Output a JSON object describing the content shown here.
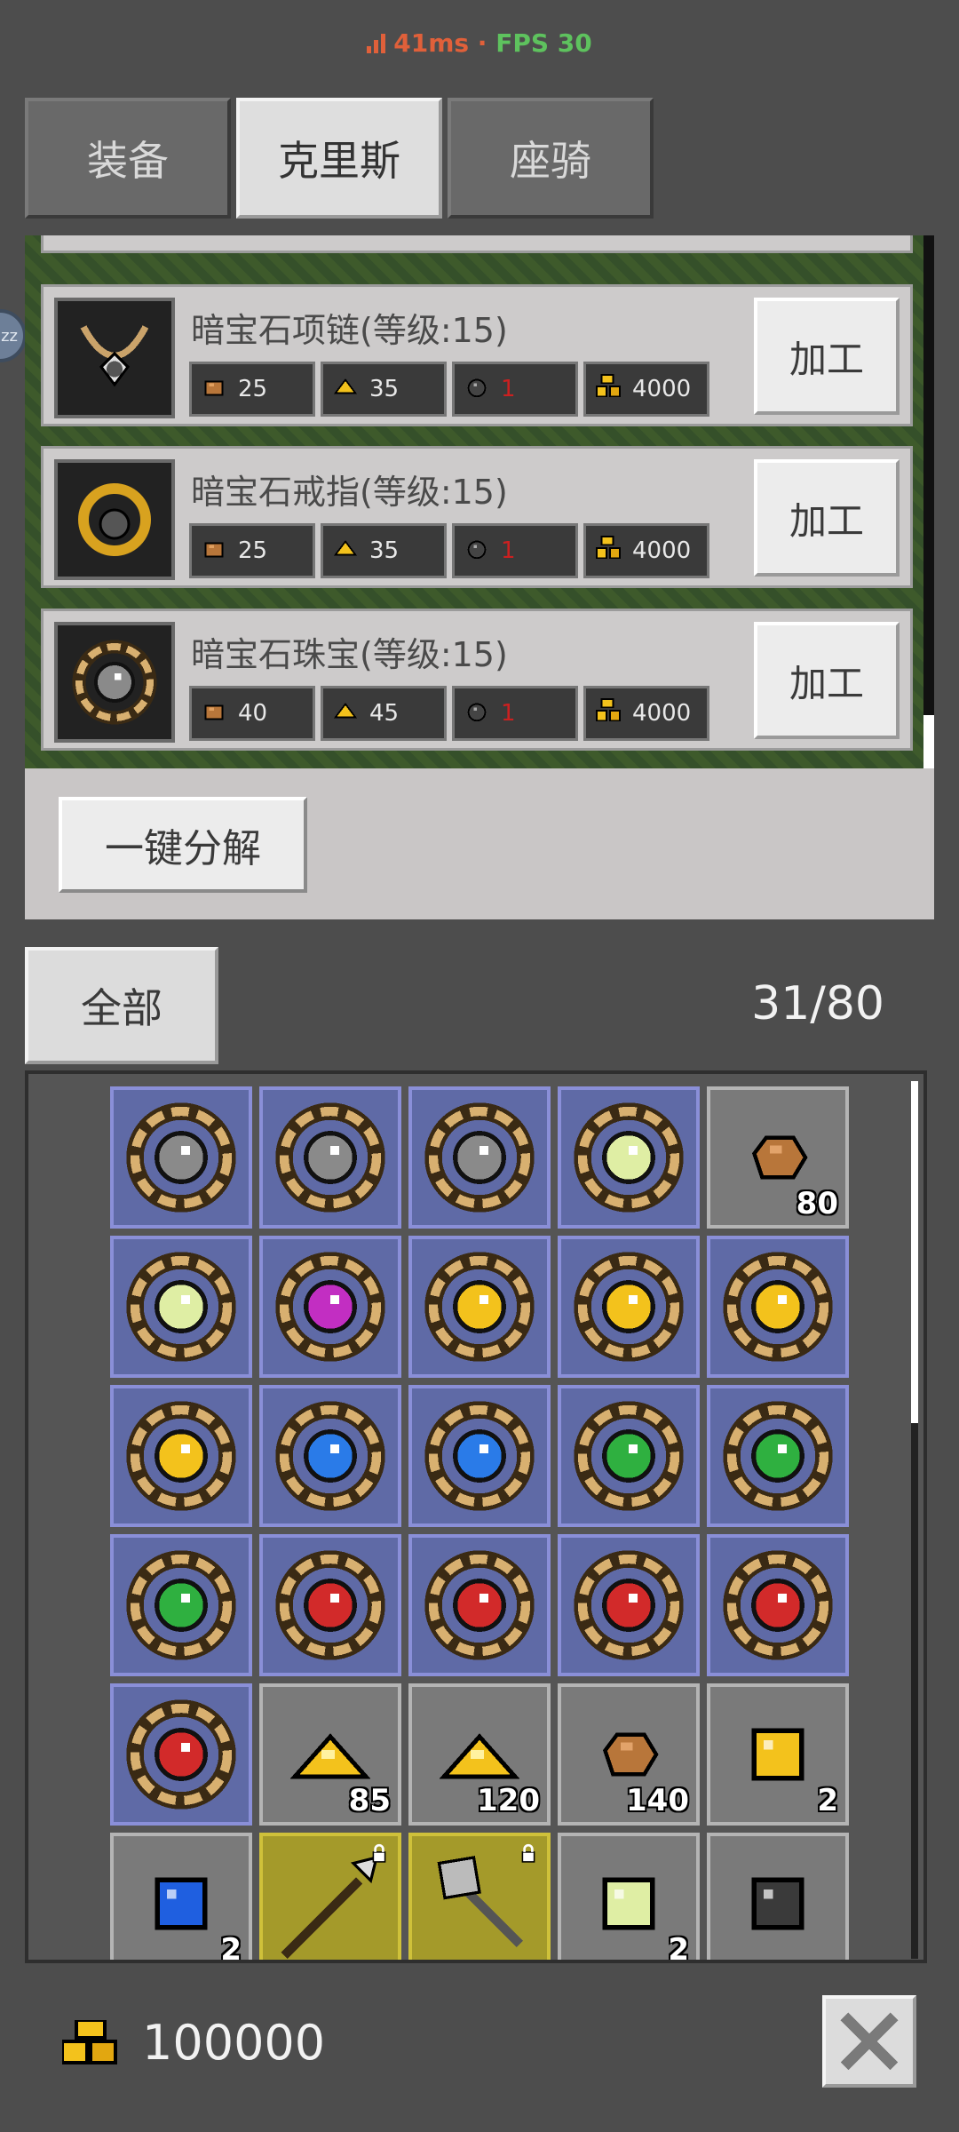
{
  "status": {
    "ping": "41ms",
    "separator": " · ",
    "fps": "FPS 30"
  },
  "tabs": [
    {
      "label": "装备",
      "active": false
    },
    {
      "label": "克里斯",
      "active": true
    },
    {
      "label": "座骑",
      "active": false
    }
  ],
  "side_bubble": "zz",
  "recipes": [
    {
      "name": "暗宝石项链(等级:15)",
      "icon": "necklace-icon",
      "mats": [
        {
          "icon": "ore-icon",
          "value": "25"
        },
        {
          "icon": "gold-pile-icon",
          "value": "35"
        },
        {
          "icon": "dark-gem-icon",
          "value": "1",
          "red": true
        },
        {
          "icon": "gold-coins-icon",
          "value": "4000"
        }
      ],
      "button": "加工"
    },
    {
      "name": "暗宝石戒指(等级:15)",
      "icon": "ring-icon",
      "mats": [
        {
          "icon": "ore-icon",
          "value": "25"
        },
        {
          "icon": "gold-pile-icon",
          "value": "35"
        },
        {
          "icon": "dark-gem-icon",
          "value": "1",
          "red": true
        },
        {
          "icon": "gold-coins-icon",
          "value": "4000"
        }
      ],
      "button": "加工"
    },
    {
      "name": "暗宝石珠宝(等级:15)",
      "icon": "jewel-icon",
      "mats": [
        {
          "icon": "ore-icon",
          "value": "40"
        },
        {
          "icon": "gold-pile-icon",
          "value": "45"
        },
        {
          "icon": "dark-gem-icon",
          "value": "1",
          "red": true
        },
        {
          "icon": "gold-coins-icon",
          "value": "4000"
        }
      ],
      "button": "加工"
    }
  ],
  "decompose_button": "一键分解",
  "filter": {
    "label": "全部"
  },
  "capacity": "31/80",
  "inventory": [
    {
      "type": "jewel",
      "gem": "#8a8a8a",
      "bg": "blue"
    },
    {
      "type": "jewel",
      "gem": "#8a8a8a",
      "bg": "blue"
    },
    {
      "type": "jewel",
      "gem": "#8a8a8a",
      "bg": "blue"
    },
    {
      "type": "jewel",
      "gem": "#dfeea4",
      "bg": "blue"
    },
    {
      "type": "ore",
      "bg": "gray",
      "count": "80"
    },
    {
      "type": "jewel",
      "gem": "#dfeea4",
      "bg": "blue"
    },
    {
      "type": "jewel",
      "gem": "#c22ec2",
      "bg": "blue"
    },
    {
      "type": "jewel",
      "gem": "#f3c21c",
      "bg": "blue"
    },
    {
      "type": "jewel",
      "gem": "#f3c21c",
      "bg": "blue"
    },
    {
      "type": "jewel",
      "gem": "#f3c21c",
      "bg": "blue"
    },
    {
      "type": "jewel",
      "gem": "#f3c21c",
      "bg": "blue"
    },
    {
      "type": "jewel",
      "gem": "#2a7be8",
      "bg": "blue"
    },
    {
      "type": "jewel",
      "gem": "#2a7be8",
      "bg": "blue"
    },
    {
      "type": "jewel",
      "gem": "#2fb040",
      "bg": "blue"
    },
    {
      "type": "jewel",
      "gem": "#2fb040",
      "bg": "blue"
    },
    {
      "type": "jewel",
      "gem": "#2fb040",
      "bg": "blue"
    },
    {
      "type": "jewel",
      "gem": "#d22a2a",
      "bg": "blue"
    },
    {
      "type": "jewel",
      "gem": "#d22a2a",
      "bg": "blue"
    },
    {
      "type": "jewel",
      "gem": "#d22a2a",
      "bg": "blue"
    },
    {
      "type": "jewel",
      "gem": "#d22a2a",
      "bg": "blue"
    },
    {
      "type": "jewel",
      "gem": "#d22a2a",
      "bg": "blue"
    },
    {
      "type": "gold",
      "bg": "gray",
      "count": "85"
    },
    {
      "type": "gold",
      "bg": "gray",
      "count": "120"
    },
    {
      "type": "ore",
      "bg": "gray",
      "count": "140"
    },
    {
      "type": "gem",
      "gem": "#f3c21c",
      "bg": "gray",
      "count": "2"
    },
    {
      "type": "gem",
      "gem": "#1f5fe0",
      "bg": "gray",
      "count": "2"
    },
    {
      "type": "spear",
      "bg": "gold",
      "locked": true
    },
    {
      "type": "axe",
      "bg": "gold",
      "locked": true
    },
    {
      "type": "gem",
      "gem": "#dfeea4",
      "bg": "gray",
      "count": "2"
    },
    {
      "type": "gem",
      "gem": "#3a3a3a",
      "bg": "gray"
    }
  ],
  "gold": "100000",
  "colors": {
    "panel": "#cdcbcb",
    "slot_blue": "#5f6aa6",
    "slot_gray": "#7a7a7a",
    "slot_gold": "#a49a2a",
    "warn_red": "#cc2020"
  }
}
